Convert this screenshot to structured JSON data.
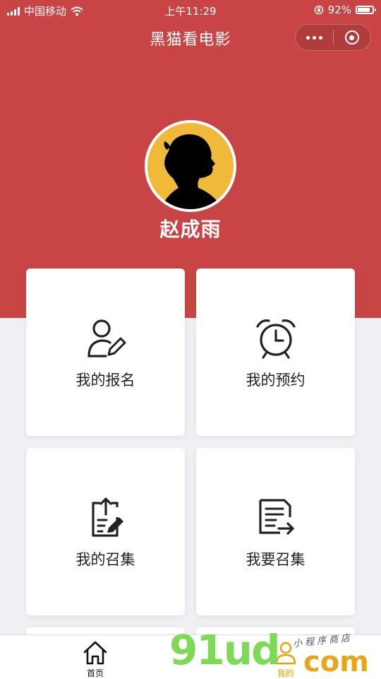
{
  "status_bar": {
    "carrier": "中国移动",
    "time": "上午11:29",
    "battery": "92%"
  },
  "nav": {
    "title": "黑猫看电影"
  },
  "profile": {
    "name": "赵成雨"
  },
  "menu": [
    {
      "label": "我的报名",
      "icon": "user-edit-icon"
    },
    {
      "label": "我的预约",
      "icon": "alarm-clock-icon"
    },
    {
      "label": "我的召集",
      "icon": "clipboard-upload-icon"
    },
    {
      "label": "我要召集",
      "icon": "document-send-icon"
    }
  ],
  "tabbar": [
    {
      "label": "首页",
      "icon": "home-icon"
    },
    {
      "label": "我的",
      "icon": "user-icon"
    }
  ],
  "watermark": {
    "main": "91ud",
    "domain": "com",
    "sub": "小程序商店"
  },
  "colors": {
    "header": "#c94545",
    "background": "#efeff4",
    "avatar_bg": "#f0b93a",
    "tab_active": "#e3a300"
  }
}
